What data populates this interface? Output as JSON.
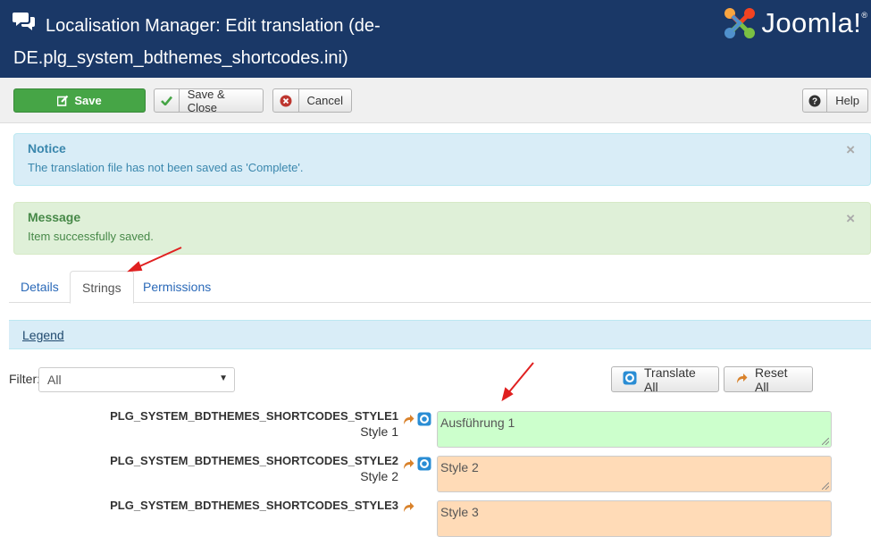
{
  "header": {
    "title": "Localisation Manager: Edit translation (de-DE.plg_system_bdthemes_shortcodes.ini)",
    "logo_text": "Joomla!",
    "logo_mark": "®",
    "bg_color": "#1a3867"
  },
  "toolbar": {
    "save_label": "Save",
    "save_close_label": "Save & Close",
    "cancel_label": "Cancel",
    "help_label": "Help"
  },
  "alerts": {
    "notice_heading": "Notice",
    "notice_text": "The translation file has not been saved as 'Complete'.",
    "message_heading": "Message",
    "message_text": "Item successfully saved.",
    "close_glyph": "×"
  },
  "tabs": [
    {
      "label": "Details",
      "active": false
    },
    {
      "label": "Strings",
      "active": true
    },
    {
      "label": "Permissions",
      "active": false
    }
  ],
  "legend": {
    "label": "Legend"
  },
  "filter": {
    "label": "Filter:",
    "selected": "All"
  },
  "actions": {
    "translate_all": "Translate All",
    "reset_all": "Reset All"
  },
  "strings": [
    {
      "key": "PLG_SYSTEM_BDTHEMES_SHORTCODES_STYLE1",
      "original": "Style 1",
      "translation": "Ausführung 1",
      "status": "translated",
      "color": "#ccffcc"
    },
    {
      "key": "PLG_SYSTEM_BDTHEMES_SHORTCODES_STYLE2",
      "original": "Style 2",
      "translation": "Style 2",
      "status": "untranslated",
      "color": "#ffdbb7"
    },
    {
      "key": "PLG_SYSTEM_BDTHEMES_SHORTCODES_STYLE3",
      "original": "",
      "translation": "Style 3",
      "status": "untranslated",
      "color": "#ffdbb7"
    }
  ],
  "icons": {
    "chat": "comments-icon",
    "save": "edit-icon",
    "check": "check-icon",
    "cancel": "cancel-circle-icon",
    "help": "question-circle-icon",
    "translate": "translate-globe-icon",
    "reset": "reply-arrow-icon"
  },
  "annotations": {
    "arrow_color": "#e02020"
  }
}
